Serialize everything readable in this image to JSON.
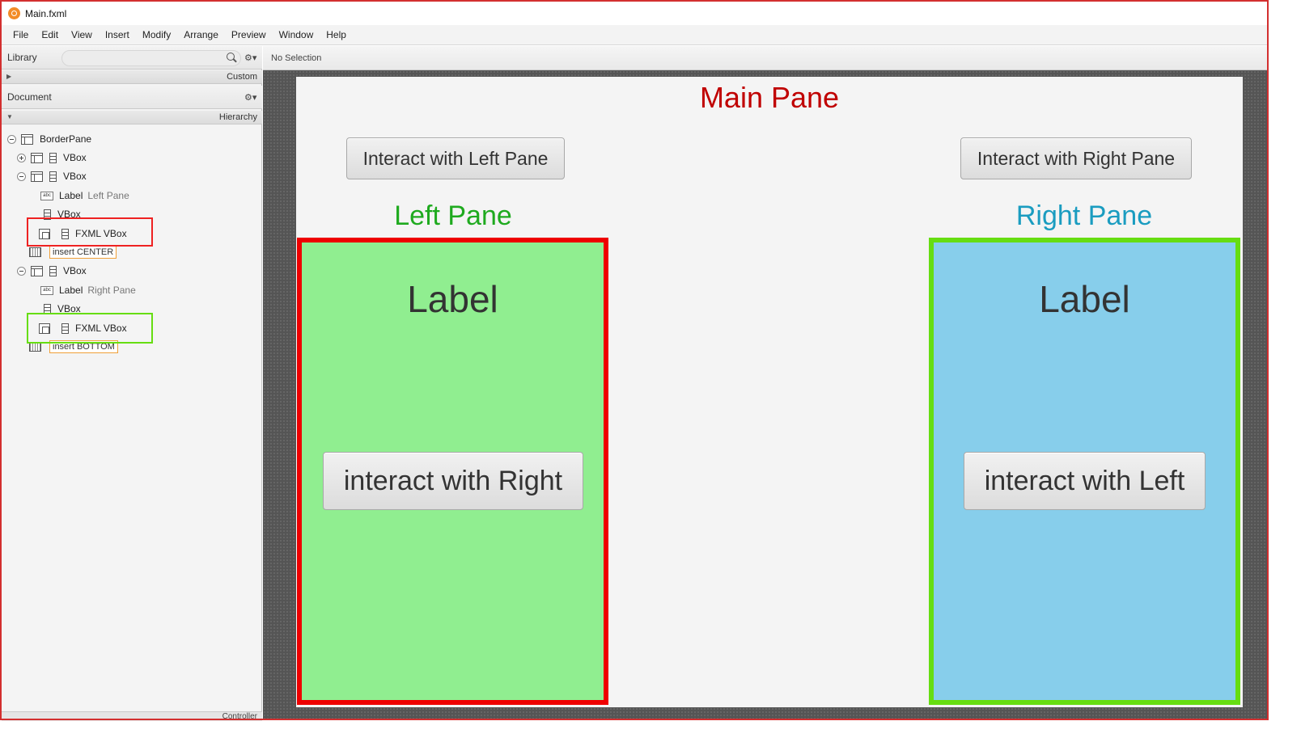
{
  "window": {
    "title": "Main.fxml"
  },
  "menu": [
    "File",
    "Edit",
    "View",
    "Insert",
    "Modify",
    "Arrange",
    "Preview",
    "Window",
    "Help"
  ],
  "library": {
    "title": "Library",
    "search_placeholder": "",
    "custom_section": "Custom"
  },
  "document": {
    "title": "Document",
    "hierarchy_section": "Hierarchy"
  },
  "tree": {
    "root": "BorderPane",
    "vbox1": "VBox",
    "vbox2": "VBox",
    "label_left_kind": "Label",
    "label_left_text": "Left Pane",
    "vbox_left_child": "VBox",
    "fxml_left": "FXML VBox",
    "insert_center": "insert CENTER",
    "vbox3": "VBox",
    "label_right_kind": "Label",
    "label_right_text": "Right Pane",
    "vbox_right_child": "VBox",
    "fxml_right": "FXML VBox",
    "insert_bottom": "insert BOTTOM"
  },
  "controller": {
    "label": "Controller"
  },
  "status": {
    "selection": "No Selection"
  },
  "content": {
    "main_title": "Main Pane",
    "btn_left": "Interact with Left Pane",
    "btn_right": "Interact with Right Pane",
    "left_title": "Left Pane",
    "right_title": "Right Pane",
    "left_label": "Label",
    "right_label": "Label",
    "left_inner_btn": "interact with Right",
    "right_inner_btn": "interact with Left"
  },
  "colors": {
    "main_title": "#c00000",
    "left_title": "#1faa1f",
    "right_title": "#1a9cc0",
    "left_fill": "#90ee90",
    "left_border": "#ee0000",
    "right_fill": "#87ceeb",
    "right_border": "#66dd11",
    "highlight_red": "#ee2222",
    "highlight_green": "#66dd11"
  },
  "icons": {
    "app": "scene-builder-icon",
    "search": "search-icon",
    "gear": "gear-icon"
  }
}
